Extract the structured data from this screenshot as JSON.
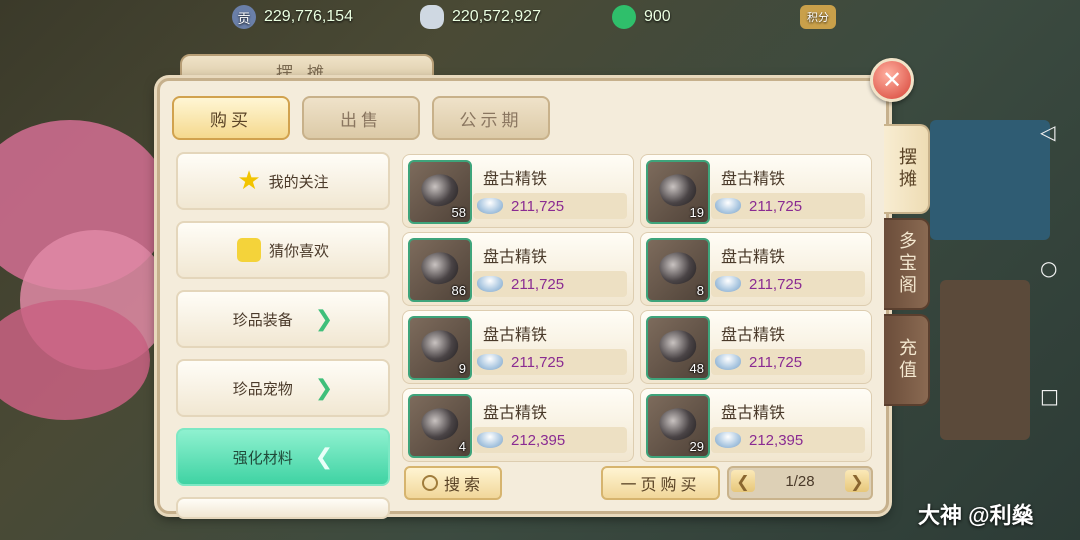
{
  "resources": [
    {
      "icon": "contribution-coin-icon",
      "icon_glyph": "贡",
      "value": "229,776,154"
    },
    {
      "icon": "silver-ingot-icon",
      "icon_glyph": "",
      "value": "220,572,927"
    },
    {
      "icon": "jade-coin-icon",
      "icon_glyph": "",
      "value": "900"
    },
    {
      "icon": "points-badge-icon",
      "icon_glyph": "积分",
      "value": ""
    }
  ],
  "panel": {
    "title": "摆摊"
  },
  "tabs": [
    {
      "label": "购买",
      "active": true
    },
    {
      "label": "出售",
      "active": false
    },
    {
      "label": "公示期",
      "active": false
    }
  ],
  "categories": [
    {
      "label": "我的关注",
      "icon": "star-icon"
    },
    {
      "label": "猜你喜欢",
      "icon": "thumbs-up-icon"
    },
    {
      "label": "珍品装备",
      "icon": "chevron-right-icon",
      "arrow": "❯"
    },
    {
      "label": "珍品宠物",
      "icon": "chevron-right-icon",
      "arrow": "❯"
    },
    {
      "label": "强化材料",
      "icon": "chevron-left-icon",
      "arrow": "❮",
      "active": true
    }
  ],
  "items": [
    {
      "name": "盘古精铁",
      "qty": "58",
      "price": "211,725"
    },
    {
      "name": "盘古精铁",
      "qty": "19",
      "price": "211,725"
    },
    {
      "name": "盘古精铁",
      "qty": "86",
      "price": "211,725"
    },
    {
      "name": "盘古精铁",
      "qty": "8",
      "price": "211,725"
    },
    {
      "name": "盘古精铁",
      "qty": "9",
      "price": "211,725"
    },
    {
      "name": "盘古精铁",
      "qty": "48",
      "price": "211,725"
    },
    {
      "name": "盘古精铁",
      "qty": "4",
      "price": "212,395"
    },
    {
      "name": "盘古精铁",
      "qty": "29",
      "price": "212,395"
    }
  ],
  "bottom": {
    "search_label": "搜索",
    "buy_page_label": "一页购买",
    "pager": {
      "prev": "❮",
      "next": "❯",
      "page": "1/28"
    }
  },
  "side_tabs": [
    {
      "label": "摆摊",
      "active": true
    },
    {
      "label": "多宝阁",
      "active": false
    },
    {
      "label": "充值",
      "active": false
    }
  ],
  "close_glyph": "✕",
  "watermark": "大神 @利燊",
  "colors": {
    "accent_green": "#3fd3a3",
    "price_purple": "#8a2b92",
    "close_red": "#d64236"
  }
}
